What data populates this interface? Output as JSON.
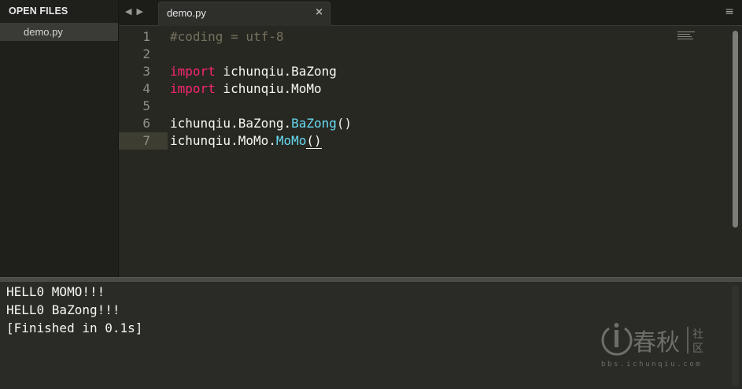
{
  "sidebar": {
    "header": "OPEN FILES",
    "files": [
      "demo.py"
    ]
  },
  "tabs": {
    "back_arrow": "◀",
    "forward_arrow": "▶",
    "active": {
      "label": "demo.py",
      "close": "×"
    },
    "menu": "≡"
  },
  "editor": {
    "line_numbers": [
      "1",
      "2",
      "3",
      "4",
      "5",
      "6",
      "7"
    ],
    "current_line": 7,
    "lines": [
      [
        {
          "t": "#coding = utf-8",
          "c": "comment"
        }
      ],
      [],
      [
        {
          "t": "import",
          "c": "keyword"
        },
        {
          "t": " ichunqiu.BaZong",
          "c": "plain"
        }
      ],
      [
        {
          "t": "import",
          "c": "keyword"
        },
        {
          "t": " ichunqiu.MoMo",
          "c": "plain"
        }
      ],
      [],
      [
        {
          "t": "ichunqiu.BaZong.",
          "c": "plain"
        },
        {
          "t": "BaZong",
          "c": "call"
        },
        {
          "t": "()",
          "c": "plain"
        }
      ],
      [
        {
          "t": "ichunqiu.MoMo.",
          "c": "plain"
        },
        {
          "t": "MoMo",
          "c": "call"
        },
        {
          "t": "()",
          "c": "paren"
        }
      ]
    ]
  },
  "output": {
    "lines": [
      "HELL0 MOMO!!!",
      "HELL0 BaZong!!!",
      "[Finished in 0.1s]"
    ]
  },
  "watermark": {
    "brand_cn": "春秋",
    "community_cn": "社区",
    "url": "bbs.ichunqiu.com"
  },
  "colors": {
    "background": "#272822",
    "keyword": "#f92672",
    "comment": "#75715e",
    "function_call": "#66d9ef",
    "text": "#f8f8f2"
  }
}
